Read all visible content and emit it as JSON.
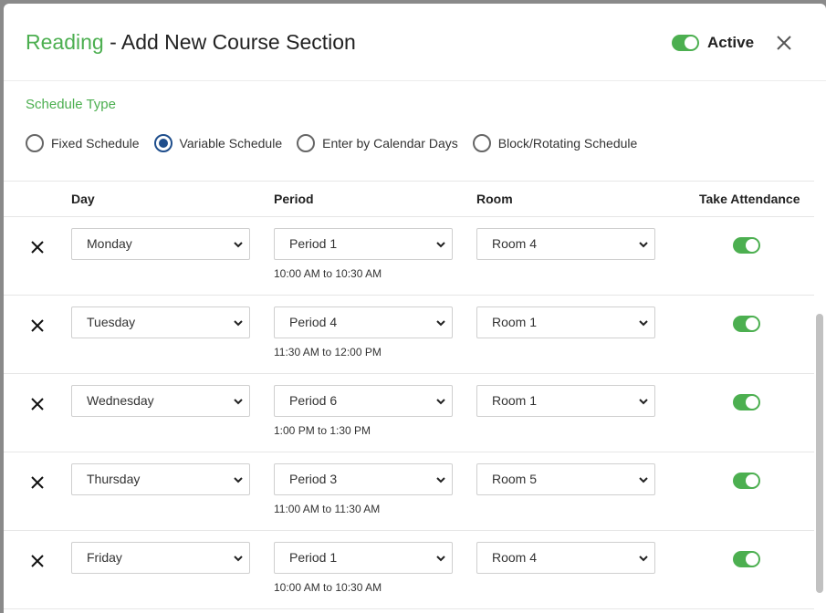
{
  "header": {
    "subject": "Reading",
    "title_rest": " - Add New Course Section",
    "active_label": "Active",
    "active": true
  },
  "schedule_type": {
    "label": "Schedule Type",
    "options": [
      {
        "label": "Fixed Schedule",
        "checked": false
      },
      {
        "label": "Variable Schedule",
        "checked": true
      },
      {
        "label": "Enter by Calendar Days",
        "checked": false
      },
      {
        "label": "Block/Rotating Schedule",
        "checked": false
      }
    ]
  },
  "table": {
    "columns": {
      "day": "Day",
      "period": "Period",
      "room": "Room",
      "attendance": "Take Attendance"
    },
    "rows": [
      {
        "day": "Monday",
        "period": "Period 1",
        "time": "10:00 AM to 10:30 AM",
        "room": "Room 4",
        "attendance": true
      },
      {
        "day": "Tuesday",
        "period": "Period 4",
        "time": "11:30 AM to 12:00 PM",
        "room": "Room 1",
        "attendance": true
      },
      {
        "day": "Wednesday",
        "period": "Period 6",
        "time": "1:00 PM to 1:30 PM",
        "room": "Room 1",
        "attendance": true
      },
      {
        "day": "Thursday",
        "period": "Period 3",
        "time": "11:00 AM to 11:30 AM",
        "room": "Room 5",
        "attendance": true
      },
      {
        "day": "Friday",
        "period": "Period 1",
        "time": "10:00 AM to 10:30 AM",
        "room": "Room 4",
        "attendance": true
      }
    ]
  },
  "colors": {
    "accent": "#4caf50",
    "radio_checked": "#1f4e8c"
  }
}
